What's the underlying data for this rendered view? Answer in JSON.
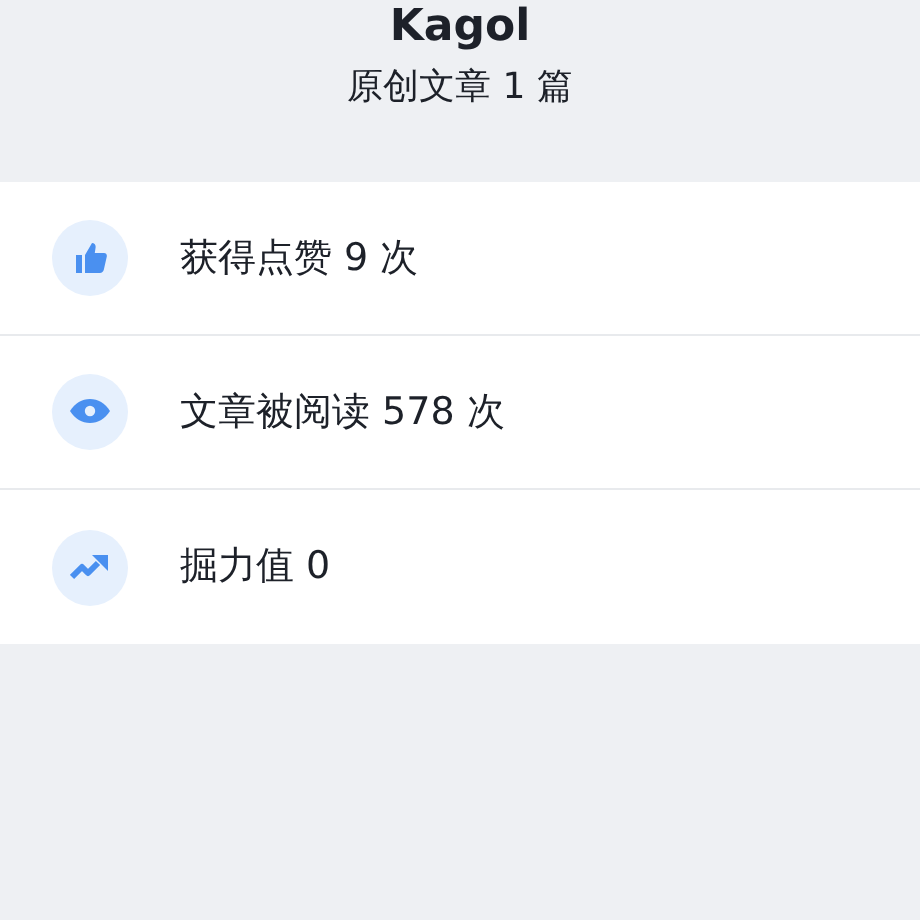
{
  "profile": {
    "name": "Kagol",
    "subtitle": "原创文章 1 篇"
  },
  "stats": [
    {
      "kind": "like",
      "label": "获得点赞 9 次"
    },
    {
      "kind": "view",
      "label": "文章被阅读 578 次"
    },
    {
      "kind": "power",
      "label": "掘力值 0"
    }
  ]
}
